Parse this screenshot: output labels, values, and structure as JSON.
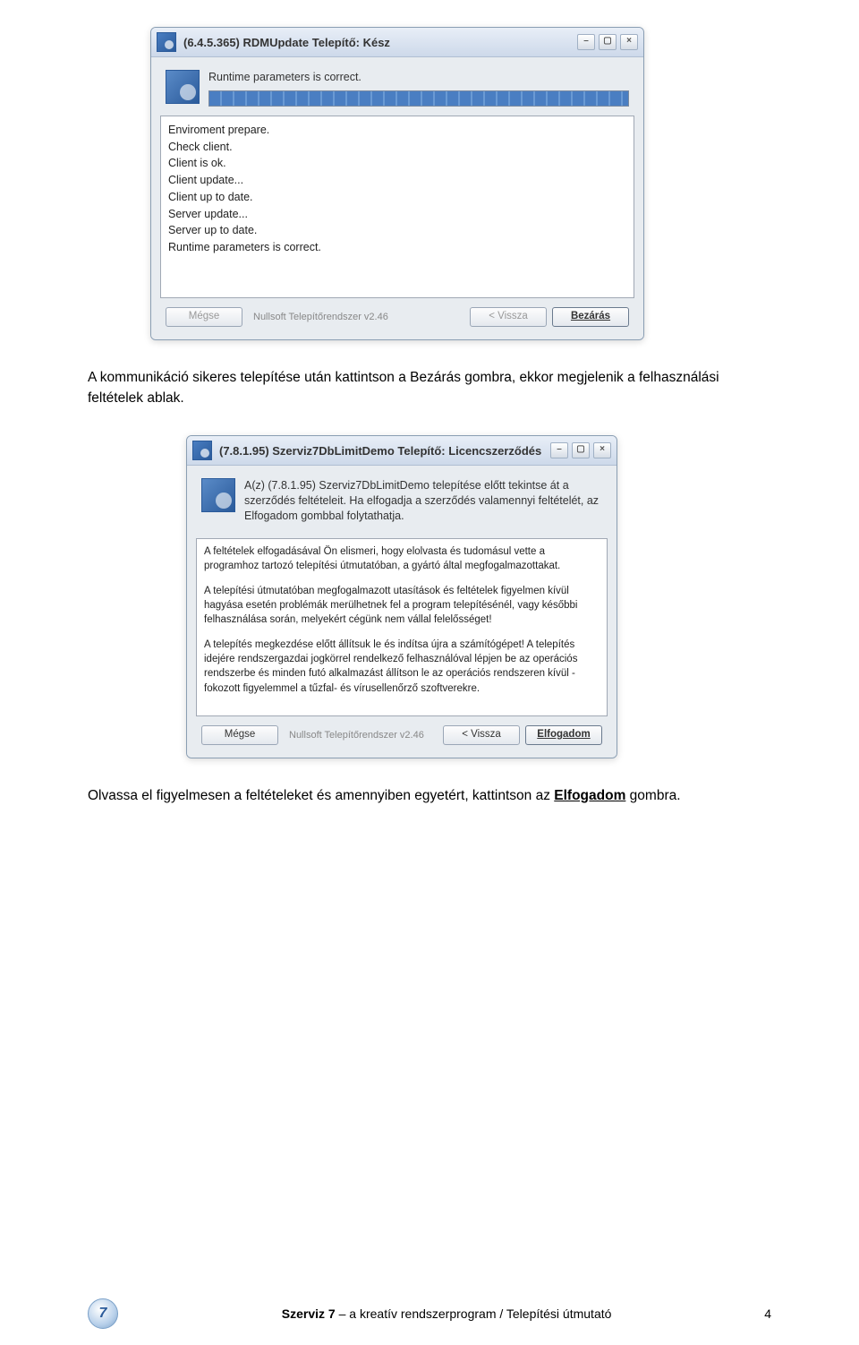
{
  "window1": {
    "title": "(6.4.5.365) RDMUpdate Telepítő: Kész",
    "status_text": "Runtime parameters is correct.",
    "log": [
      "Enviroment prepare.",
      "Check client.",
      "Client is ok.",
      "Client update...",
      "Client up to date.",
      "Server update...",
      "Server up to date.",
      "Runtime parameters is correct."
    ],
    "buttons": {
      "cancel": "Mégse",
      "nsis": "Nullsoft Telepítőrendszer v2.46",
      "back": "< Vissza",
      "close": "Bezárás"
    }
  },
  "paragraph1": "A kommunikáció sikeres telepítése után kattintson a Bezárás gombra, ekkor megjelenik a felhasználási feltételek ablak.",
  "window2": {
    "title": "(7.8.1.95) Szerviz7DbLimitDemo Telepítő: Licencszerződés",
    "intro": "A(z) (7.8.1.95) Szerviz7DbLimitDemo telepítése előtt tekintse át a szerződés feltételeit. Ha elfogadja a szerződés valamennyi feltételét, az Elfogadom gombbal folytathatja.",
    "license": {
      "p1": "A feltételek elfogadásával Ön elismeri, hogy elolvasta és tudomásul vette a programhoz tartozó telepítési útmutatóban, a gyártó által megfogalmazottakat.",
      "p2": "A telepítési útmutatóban megfogalmazott utasítások és feltételek figyelmen kívül hagyása esetén problémák merülhetnek fel a program telepítésénél, vagy későbbi felhasználása során, melyekért cégünk nem vállal felelősséget!",
      "p3": "A telepítés megkezdése előtt állítsuk le és indítsa újra a számítógépet! A telepítés idejére rendszergazdai jogkörrel rendelkező felhasználóval lépjen be az operációs rendszerbe és minden futó alkalmazást állítson le az operációs rendszeren kívül - fokozott figyelemmel a tűzfal- és vírusellenőrző szoftverekre."
    },
    "buttons": {
      "cancel": "Mégse",
      "nsis": "Nullsoft Telepítőrendszer v2.46",
      "back": "< Vissza",
      "accept": "Elfogadom"
    }
  },
  "paragraph2_pre": "Olvassa el figyelmesen a feltételeket és amennyiben egyetért, kattintson az ",
  "paragraph2_link": "Elfogadom",
  "paragraph2_post": " gombra.",
  "footer": {
    "brand": "Szerviz 7",
    "tagline": " – a kreatív rendszerprogram / Telepítési útmutató",
    "page": "4",
    "icon_glyph": "7"
  }
}
